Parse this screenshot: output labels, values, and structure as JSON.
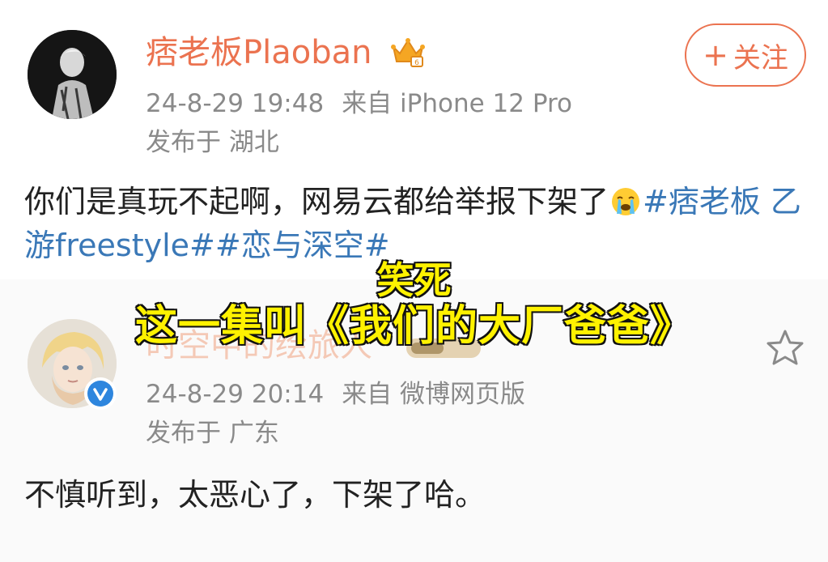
{
  "post1": {
    "username": "痞老板Plaoban",
    "timestamp": "24-8-29 19:48",
    "source": "来自 iPhone 12 Pro",
    "location": "发布于 湖北",
    "follow_label": "关注",
    "follow_plus": "+",
    "text": "你们是真玩不起啊，网易云都给举报下架了",
    "hashtags": "#痞老板 乙游freestyle##恋与深空#",
    "emoji": "crying-face-icon"
  },
  "post2": {
    "username": "时空中的绘旅人",
    "timestamp": "24-8-29 20:14",
    "source": "来自 微博网页版",
    "location": "发布于 广东",
    "text": "不慎听到，太恶心了，下架了哈。",
    "verified": true
  },
  "subtitles": {
    "line1": "笑死",
    "line2": "这一集叫《我们的大厂爸爸》"
  },
  "colors": {
    "brand_orange": "#eb7350",
    "hashtag_blue": "#3a78b7",
    "meta_gray": "#8a8a8a",
    "subtitle_yellow": "#fff200",
    "verified_blue": "#2e86de"
  }
}
